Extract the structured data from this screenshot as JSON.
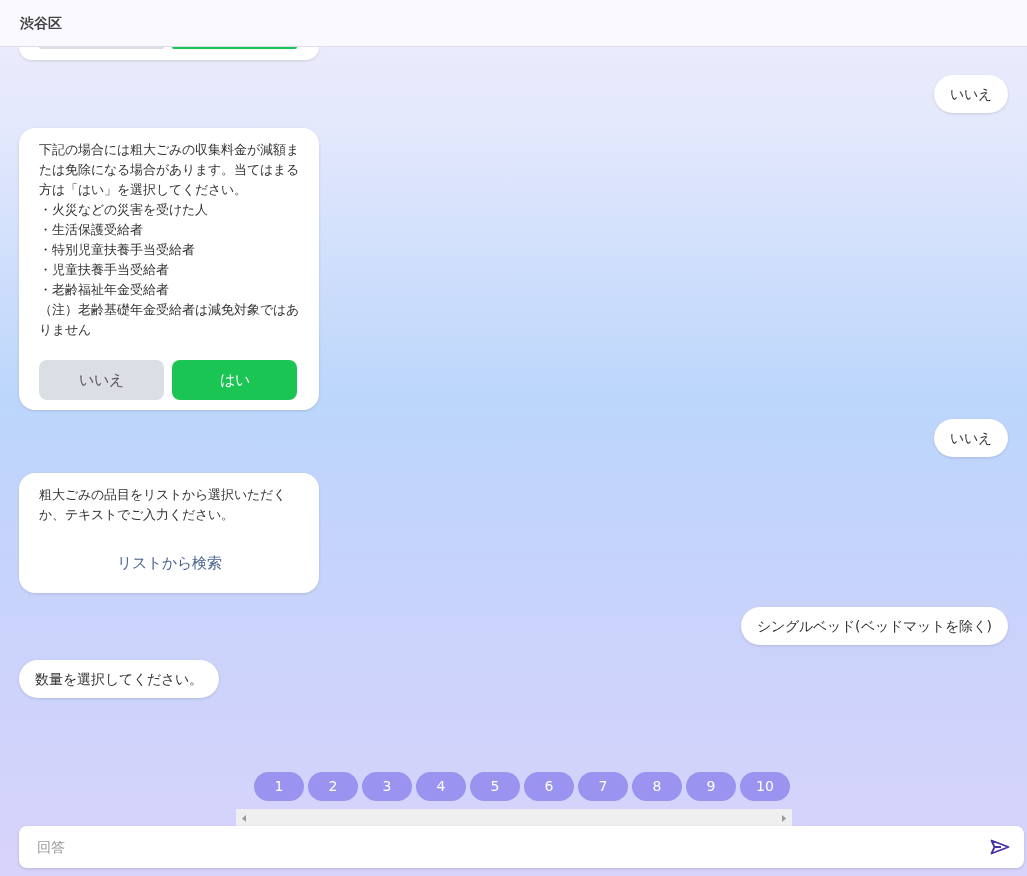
{
  "header": {
    "title": "渋谷区"
  },
  "messages": [
    {
      "kind": "clipped_choice"
    },
    {
      "kind": "user",
      "text": "いいえ"
    },
    {
      "kind": "bot_choice",
      "text": "下記の場合には粗大ごみの収集料金が減額または免除になる場合があります。当てはまる方は「はい」を選択してください。",
      "items": [
        "・火災などの災害を受けた人",
        "・生活保護受給者",
        "・特別児童扶養手当受給者",
        "・児童扶養手当受給者",
        "・老齢福祉年金受給者"
      ],
      "note": "（注）老齢基礎年金受給者は減免対象ではありません",
      "buttons": [
        {
          "label": "いいえ",
          "kind": "no"
        },
        {
          "label": "はい",
          "kind": "yes"
        }
      ]
    },
    {
      "kind": "user",
      "text": "いいえ"
    },
    {
      "kind": "bot_link",
      "text": "粗大ごみの品目をリストから選択いただくか、テキストでご入力ください。",
      "link": "リストから検索"
    },
    {
      "kind": "user",
      "text": "シングルベッド(ベッドマットを除く)"
    },
    {
      "kind": "bot",
      "text": "数量を選択してください。"
    }
  ],
  "quick_replies": [
    "1",
    "2",
    "3",
    "4",
    "5",
    "6",
    "7",
    "8",
    "9",
    "10"
  ],
  "composer": {
    "placeholder": "回答"
  }
}
